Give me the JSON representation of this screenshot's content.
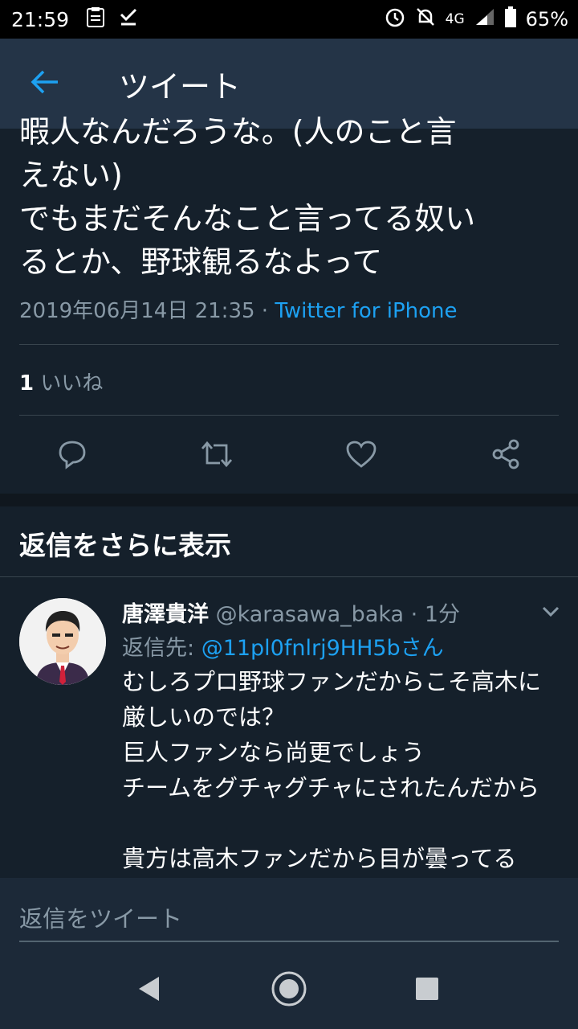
{
  "status_bar": {
    "time": "21:59",
    "network": "4G",
    "battery": "65%"
  },
  "header": {
    "title": "ツイート"
  },
  "tweet": {
    "text": "暇人なんだろうな。(人のこと言\nえない)\nでもまだそんなこと言ってる奴い\nるとか、野球観るなよって",
    "date": "2019年06月14日 21:35 · ",
    "source": "Twitter for iPhone",
    "likes_count": "1",
    "likes_label": " いいね"
  },
  "more_replies": {
    "label": "返信をさらに表示"
  },
  "reply": {
    "name": "唐澤貴洋",
    "handle": " @karasawa_baka · 1分",
    "reply_to_label": "返信先: ",
    "reply_to_user": "@11pl0fnlrj9HH5bさん",
    "text": "むしろプロ野球ファンだからこそ高木に\n厳しいのでは？\n巨人ファンなら尚更でしょう\nチームをグチャグチャにされたんだから\n\n貴方は高木ファンだから目が曇ってる"
  },
  "compose": {
    "placeholder": "返信をツイート"
  },
  "colors": {
    "background": "#15202b",
    "appbar": "#243447",
    "accent": "#1da1f2",
    "muted": "#8899a6"
  }
}
